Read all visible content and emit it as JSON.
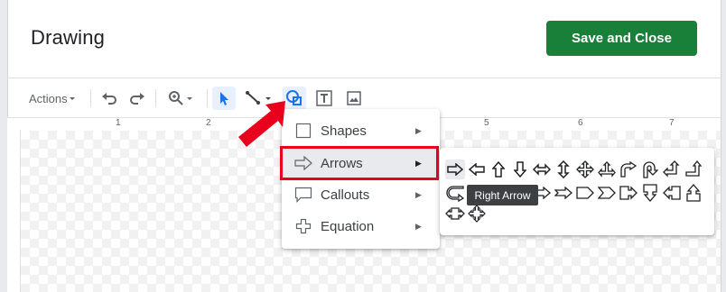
{
  "dialog": {
    "title": "Drawing",
    "save_close_label": "Save and Close"
  },
  "toolbar": {
    "actions_label": "Actions",
    "icons": [
      "undo-icon",
      "redo-icon",
      "zoom-icon",
      "select-icon",
      "line-icon",
      "shape-icon",
      "textbox-icon",
      "image-icon"
    ]
  },
  "ruler": {
    "numbers": [
      "1",
      "2",
      "5",
      "6",
      "7"
    ]
  },
  "shape_menu": {
    "items": [
      {
        "label": "Shapes",
        "icon": "square-icon"
      },
      {
        "label": "Arrows",
        "icon": "arrow-icon"
      },
      {
        "label": "Callouts",
        "icon": "callout-icon"
      },
      {
        "label": "Equation",
        "icon": "plus-icon"
      }
    ],
    "active": "Arrows"
  },
  "arrows_submenu": {
    "tooltip": "Right Arrow",
    "icons": [
      "right-arrow",
      "left-arrow",
      "up-arrow",
      "down-arrow",
      "left-right-arrow",
      "up-down-arrow",
      "quad-arrow",
      "left-right-up-arrow",
      "bent-arrow",
      "u-turn-arrow",
      "left-up-arrow",
      "bent-up-arrow",
      "curved-arrow",
      "striped-right-arrow",
      "notched-right-arrow",
      "pentagon",
      "chevron",
      "right-arrow-callout",
      "down-arrow-callout",
      "left-arrow-callout",
      "up-arrow-callout",
      "left-right-arrow-callout",
      "quad-arrow-callout"
    ]
  },
  "colors": {
    "primary_green": "#188038",
    "annotation_red": "#e8001c",
    "selected_tool": "#1a73e8"
  }
}
